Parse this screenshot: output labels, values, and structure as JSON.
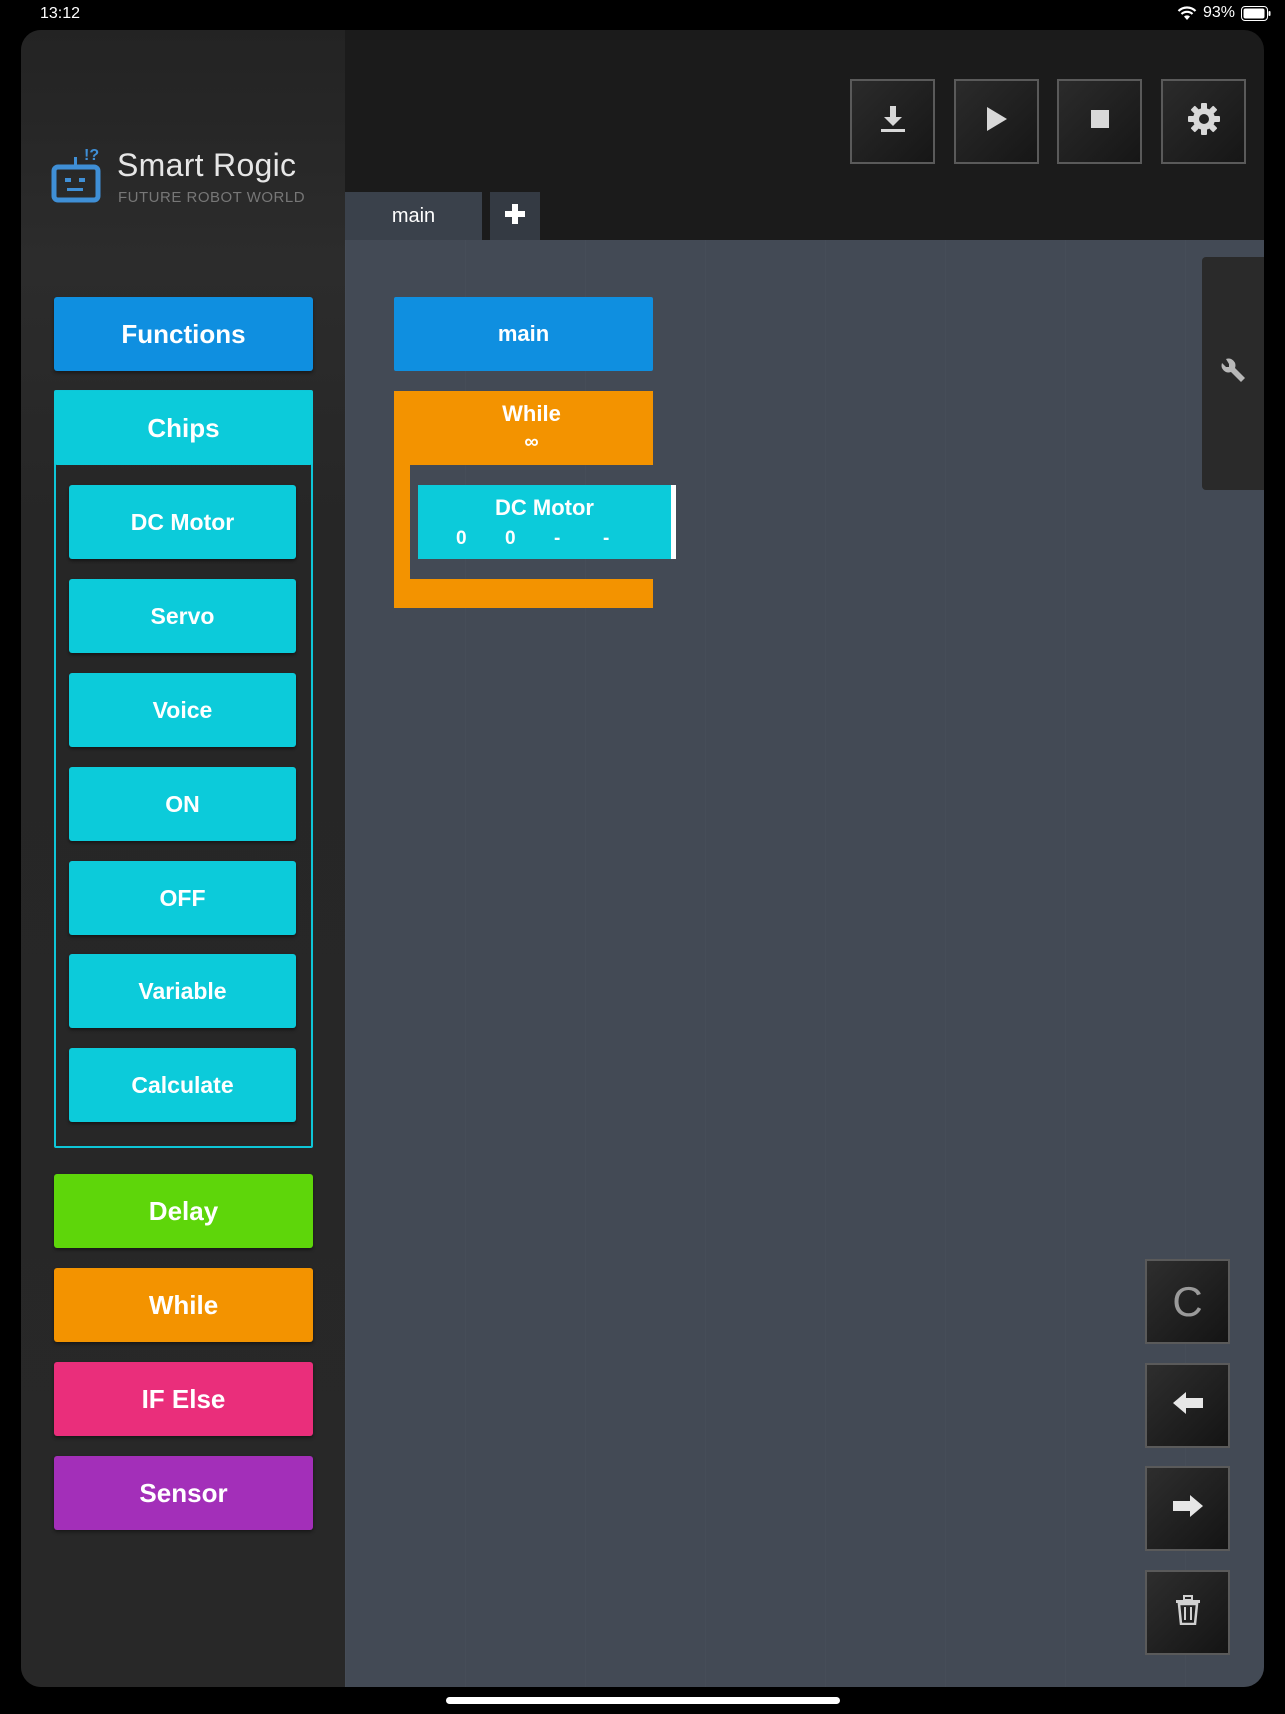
{
  "status": {
    "time": "13:12",
    "battery": "93%"
  },
  "app": {
    "title": "Smart Rogic",
    "subtitle": "FUTURE ROBOT WORLD"
  },
  "sidebar": {
    "functions": "Functions",
    "chips": "Chips",
    "chip_items": [
      "DC Motor",
      "Servo",
      "Voice",
      "ON",
      "OFF",
      "Variable",
      "Calculate"
    ],
    "delay": "Delay",
    "while": "While",
    "if_else": "IF Else",
    "sensor": "Sensor"
  },
  "tabs": {
    "main": "main"
  },
  "canvas": {
    "main_block": "main",
    "while_block": {
      "title": "While",
      "condition": "∞"
    },
    "dc_block": {
      "title": "DC Motor",
      "params": [
        "0",
        "0",
        "-",
        "-"
      ]
    }
  },
  "controls": {
    "clear": "C"
  },
  "colors": {
    "functions": "#0f8fe0",
    "chips": "#0ccbda",
    "delay": "#5ed60a",
    "while": "#f39300",
    "if_else": "#ea2e7b",
    "sensor": "#a32fb9",
    "canvas": "#434a55"
  }
}
